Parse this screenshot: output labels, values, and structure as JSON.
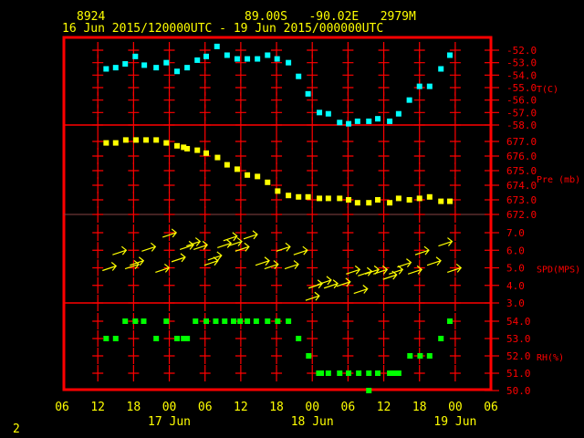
{
  "header": {
    "station": "8924",
    "location": "89.00S   -90.02E   2979M",
    "period": "16 Jun 2015/120000UTC - 19 Jun 2015/000000UTC",
    "page_number": "2"
  },
  "colors": {
    "frame": "#ff0000",
    "text": "#ffff00",
    "temp": "#00ffff",
    "pressure": "#ffff00",
    "wind": "#ffff00",
    "rh": "#00ff00"
  },
  "chart_data": {
    "type": "scatter",
    "time_unit": "hours since 16 Jun 2015 12UTC",
    "x_ticks": [
      {
        "h": -6,
        "label": "06"
      },
      {
        "h": 0,
        "label": "12"
      },
      {
        "h": 6,
        "label": "18"
      },
      {
        "h": 12,
        "label": "00"
      },
      {
        "h": 18,
        "label": "06"
      },
      {
        "h": 24,
        "label": "12"
      },
      {
        "h": 30,
        "label": "18"
      },
      {
        "h": 36,
        "label": "00"
      },
      {
        "h": 42,
        "label": "06"
      },
      {
        "h": 48,
        "label": "12"
      },
      {
        "h": 54,
        "label": "18"
      },
      {
        "h": 60,
        "label": "00"
      },
      {
        "h": 66,
        "label": "06"
      }
    ],
    "date_labels": [
      {
        "h": 12,
        "label": "17 Jun"
      },
      {
        "h": 36,
        "label": "18 Jun"
      },
      {
        "h": 60,
        "label": "19 Jun"
      }
    ],
    "xlim": [
      -6,
      66
    ],
    "panels": [
      {
        "name": "temperature",
        "ylabel": "T(C)",
        "ylim": [
          -58,
          -52
        ],
        "ticks": [
          "-52.0",
          "-53.0",
          "-54.0",
          "-55.0",
          "-56.0",
          "-57.0",
          "-58.0"
        ],
        "tick_values": [
          -52,
          -53,
          -54,
          -55,
          -56,
          -57,
          -58
        ],
        "marker": "square",
        "color": "#00ffff",
        "t": [
          1.4,
          3.0,
          4.6,
          6.3,
          7.8,
          9.8,
          11.5,
          13.3,
          15.0,
          16.7,
          18.2,
          20.0,
          21.7,
          23.4,
          25.1,
          26.8,
          28.5,
          30.1,
          32.0,
          33.7,
          35.3,
          37.2,
          38.7,
          40.6,
          42.1,
          43.6,
          45.5,
          47.0,
          49.0,
          50.5,
          52.3,
          54.0,
          55.7,
          57.6,
          59.1
        ],
        "values": [
          -53.5,
          -53.4,
          -53.1,
          -52.5,
          -53.2,
          -53.4,
          -53.0,
          -53.7,
          -53.4,
          -52.8,
          -52.5,
          -51.7,
          -52.4,
          -52.7,
          -52.7,
          -52.7,
          -52.4,
          -52.7,
          -53.0,
          -54.1,
          -55.5,
          -57.0,
          -57.1,
          -57.8,
          -57.9,
          -57.7,
          -57.7,
          -57.5,
          -57.7,
          -57.1,
          -56.0,
          -54.9,
          -54.9,
          -53.5,
          -52.4
        ]
      },
      {
        "name": "pressure",
        "ylabel": "Pre (mb)",
        "ylim": [
          672,
          677
        ],
        "ticks": [
          "677.0",
          "676.0",
          "675.0",
          "674.0",
          "673.0",
          "672.0"
        ],
        "tick_values": [
          677,
          676,
          675,
          674,
          673,
          672
        ],
        "marker": "square",
        "color": "#ffff00",
        "t": [
          1.4,
          3.0,
          4.7,
          6.4,
          8.1,
          9.8,
          11.5,
          13.3,
          14.4,
          15.0,
          16.7,
          18.2,
          20.1,
          21.7,
          23.4,
          25.1,
          26.8,
          28.5,
          30.2,
          32.0,
          33.7,
          35.3,
          37.2,
          38.7,
          40.6,
          42.1,
          43.6,
          45.5,
          47.0,
          49.0,
          50.5,
          52.3,
          54.0,
          55.7,
          57.6,
          59.1
        ],
        "values": [
          676.9,
          676.9,
          677.1,
          677.1,
          677.1,
          677.1,
          676.9,
          676.7,
          676.6,
          676.5,
          676.4,
          676.2,
          675.9,
          675.4,
          675.1,
          674.7,
          674.6,
          674.2,
          673.6,
          673.3,
          673.2,
          673.2,
          673.1,
          673.1,
          673.1,
          673.0,
          672.8,
          672.8,
          673.0,
          672.8,
          673.1,
          673.0,
          673.1,
          673.2,
          672.9,
          672.9
        ]
      },
      {
        "name": "wind_speed",
        "ylabel": "SPD(MPS)",
        "ylim": [
          3,
          7
        ],
        "ticks": [
          "7.0",
          "6.0",
          "5.0",
          "4.0",
          "3.0"
        ],
        "tick_values": [
          7,
          6,
          5,
          4,
          3
        ],
        "marker": "arrow",
        "color": "#ffff00",
        "t": [
          2.0,
          3.7,
          5.8,
          6.6,
          8.6,
          10.9,
          12.1,
          13.6,
          15.0,
          16.1,
          17.3,
          19.1,
          19.7,
          21.3,
          22.3,
          23.1,
          24.3,
          25.7,
          27.7,
          29.2,
          31.2,
          32.6,
          34.1,
          36.1,
          36.6,
          38.1,
          39.2,
          41.3,
          42.9,
          44.2,
          44.9,
          46.1,
          47.5,
          49.1,
          50.1,
          51.5,
          53.3,
          54.5,
          56.5,
          58.4,
          59.9
        ],
        "values": [
          5.0,
          5.9,
          5.1,
          5.3,
          6.1,
          4.9,
          6.9,
          5.5,
          6.2,
          6.4,
          6.2,
          5.3,
          5.6,
          6.3,
          6.7,
          6.4,
          6.1,
          6.8,
          5.3,
          5.1,
          6.1,
          5.1,
          5.9,
          3.3,
          4.0,
          4.2,
          4.0,
          4.1,
          4.8,
          3.7,
          4.7,
          4.8,
          4.8,
          4.5,
          4.8,
          5.2,
          4.8,
          5.9,
          5.3,
          6.4,
          4.9
        ]
      },
      {
        "name": "relative_humidity",
        "ylabel": "RH(%)",
        "ylim": [
          50,
          54
        ],
        "ticks": [
          "54.0",
          "53.0",
          "52.0",
          "51.0",
          "50.0"
        ],
        "tick_values": [
          54,
          53,
          52,
          51,
          50
        ],
        "marker": "square",
        "color": "#00ff00",
        "t": [
          4.6,
          6.3,
          7.7,
          11.5,
          16.4,
          18.2,
          19.8,
          21.3,
          22.8,
          23.9,
          25.1,
          26.6,
          28.5,
          30.2,
          32.0,
          59.1,
          1.4,
          3.0,
          9.8,
          13.3,
          14.4,
          15.0,
          33.7,
          57.6,
          35.4,
          52.4,
          54.1,
          55.7,
          37.1,
          37.5,
          38.7,
          40.6,
          42.1,
          43.8,
          45.5,
          47.0,
          49.0,
          49.6,
          50.5,
          45.5
        ],
        "values": [
          54,
          54,
          54,
          54,
          54,
          54,
          54,
          54,
          54,
          54,
          54,
          54,
          54,
          54,
          54,
          54,
          53,
          53,
          53,
          53,
          53,
          53,
          53,
          53,
          52,
          52,
          52,
          52,
          51,
          51,
          51,
          51,
          51,
          51,
          51,
          51,
          51,
          51,
          51,
          50
        ]
      }
    ]
  }
}
